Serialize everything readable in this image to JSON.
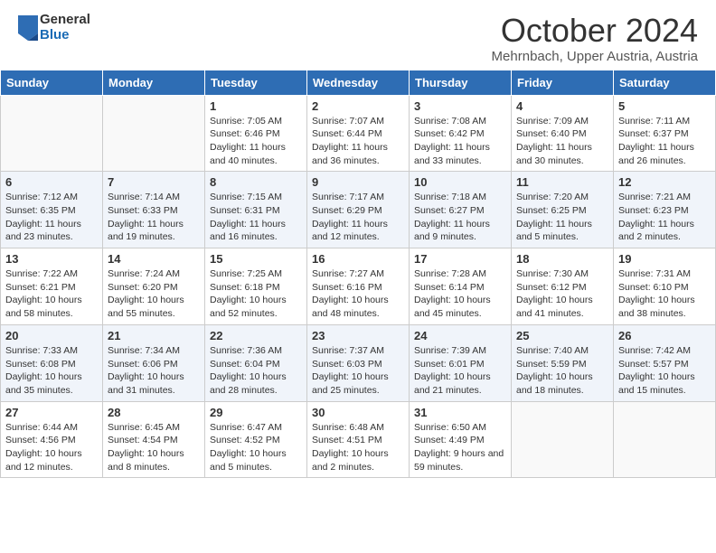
{
  "header": {
    "logo_general": "General",
    "logo_blue": "Blue",
    "month_title": "October 2024",
    "location": "Mehrnbach, Upper Austria, Austria"
  },
  "days_of_week": [
    "Sunday",
    "Monday",
    "Tuesday",
    "Wednesday",
    "Thursday",
    "Friday",
    "Saturday"
  ],
  "weeks": [
    [
      {
        "day": "",
        "info": ""
      },
      {
        "day": "",
        "info": ""
      },
      {
        "day": "1",
        "info": "Sunrise: 7:05 AM\nSunset: 6:46 PM\nDaylight: 11 hours and 40 minutes."
      },
      {
        "day": "2",
        "info": "Sunrise: 7:07 AM\nSunset: 6:44 PM\nDaylight: 11 hours and 36 minutes."
      },
      {
        "day": "3",
        "info": "Sunrise: 7:08 AM\nSunset: 6:42 PM\nDaylight: 11 hours and 33 minutes."
      },
      {
        "day": "4",
        "info": "Sunrise: 7:09 AM\nSunset: 6:40 PM\nDaylight: 11 hours and 30 minutes."
      },
      {
        "day": "5",
        "info": "Sunrise: 7:11 AM\nSunset: 6:37 PM\nDaylight: 11 hours and 26 minutes."
      }
    ],
    [
      {
        "day": "6",
        "info": "Sunrise: 7:12 AM\nSunset: 6:35 PM\nDaylight: 11 hours and 23 minutes."
      },
      {
        "day": "7",
        "info": "Sunrise: 7:14 AM\nSunset: 6:33 PM\nDaylight: 11 hours and 19 minutes."
      },
      {
        "day": "8",
        "info": "Sunrise: 7:15 AM\nSunset: 6:31 PM\nDaylight: 11 hours and 16 minutes."
      },
      {
        "day": "9",
        "info": "Sunrise: 7:17 AM\nSunset: 6:29 PM\nDaylight: 11 hours and 12 minutes."
      },
      {
        "day": "10",
        "info": "Sunrise: 7:18 AM\nSunset: 6:27 PM\nDaylight: 11 hours and 9 minutes."
      },
      {
        "day": "11",
        "info": "Sunrise: 7:20 AM\nSunset: 6:25 PM\nDaylight: 11 hours and 5 minutes."
      },
      {
        "day": "12",
        "info": "Sunrise: 7:21 AM\nSunset: 6:23 PM\nDaylight: 11 hours and 2 minutes."
      }
    ],
    [
      {
        "day": "13",
        "info": "Sunrise: 7:22 AM\nSunset: 6:21 PM\nDaylight: 10 hours and 58 minutes."
      },
      {
        "day": "14",
        "info": "Sunrise: 7:24 AM\nSunset: 6:20 PM\nDaylight: 10 hours and 55 minutes."
      },
      {
        "day": "15",
        "info": "Sunrise: 7:25 AM\nSunset: 6:18 PM\nDaylight: 10 hours and 52 minutes."
      },
      {
        "day": "16",
        "info": "Sunrise: 7:27 AM\nSunset: 6:16 PM\nDaylight: 10 hours and 48 minutes."
      },
      {
        "day": "17",
        "info": "Sunrise: 7:28 AM\nSunset: 6:14 PM\nDaylight: 10 hours and 45 minutes."
      },
      {
        "day": "18",
        "info": "Sunrise: 7:30 AM\nSunset: 6:12 PM\nDaylight: 10 hours and 41 minutes."
      },
      {
        "day": "19",
        "info": "Sunrise: 7:31 AM\nSunset: 6:10 PM\nDaylight: 10 hours and 38 minutes."
      }
    ],
    [
      {
        "day": "20",
        "info": "Sunrise: 7:33 AM\nSunset: 6:08 PM\nDaylight: 10 hours and 35 minutes."
      },
      {
        "day": "21",
        "info": "Sunrise: 7:34 AM\nSunset: 6:06 PM\nDaylight: 10 hours and 31 minutes."
      },
      {
        "day": "22",
        "info": "Sunrise: 7:36 AM\nSunset: 6:04 PM\nDaylight: 10 hours and 28 minutes."
      },
      {
        "day": "23",
        "info": "Sunrise: 7:37 AM\nSunset: 6:03 PM\nDaylight: 10 hours and 25 minutes."
      },
      {
        "day": "24",
        "info": "Sunrise: 7:39 AM\nSunset: 6:01 PM\nDaylight: 10 hours and 21 minutes."
      },
      {
        "day": "25",
        "info": "Sunrise: 7:40 AM\nSunset: 5:59 PM\nDaylight: 10 hours and 18 minutes."
      },
      {
        "day": "26",
        "info": "Sunrise: 7:42 AM\nSunset: 5:57 PM\nDaylight: 10 hours and 15 minutes."
      }
    ],
    [
      {
        "day": "27",
        "info": "Sunrise: 6:44 AM\nSunset: 4:56 PM\nDaylight: 10 hours and 12 minutes."
      },
      {
        "day": "28",
        "info": "Sunrise: 6:45 AM\nSunset: 4:54 PM\nDaylight: 10 hours and 8 minutes."
      },
      {
        "day": "29",
        "info": "Sunrise: 6:47 AM\nSunset: 4:52 PM\nDaylight: 10 hours and 5 minutes."
      },
      {
        "day": "30",
        "info": "Sunrise: 6:48 AM\nSunset: 4:51 PM\nDaylight: 10 hours and 2 minutes."
      },
      {
        "day": "31",
        "info": "Sunrise: 6:50 AM\nSunset: 4:49 PM\nDaylight: 9 hours and 59 minutes."
      },
      {
        "day": "",
        "info": ""
      },
      {
        "day": "",
        "info": ""
      }
    ]
  ]
}
